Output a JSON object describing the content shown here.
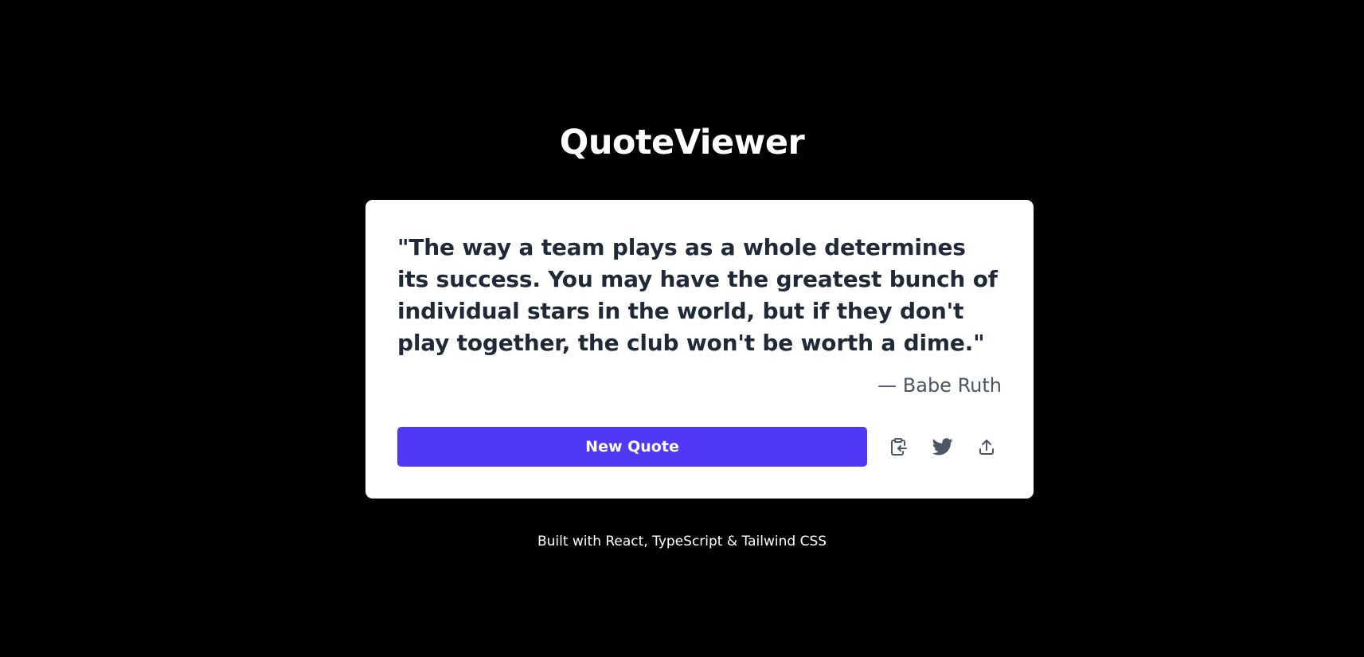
{
  "app": {
    "title": "QuoteViewer"
  },
  "quote": {
    "text": "\"The way a team plays as a whole determines its success. You may have the greatest bunch of individual stars in the world, but if they don't play together, the club won't be worth a dime.\"",
    "author": "— Babe Ruth"
  },
  "actions": {
    "new_quote_label": "New Quote",
    "icons": [
      "clipboard-copy-icon",
      "twitter-icon",
      "share-upload-icon"
    ]
  },
  "footer": {
    "text": "Built with React, TypeScript & Tailwind CSS"
  },
  "colors": {
    "background": "#000000",
    "card": "#ffffff",
    "accent": "#4f39f6",
    "quote_text": "#1f2937",
    "author_text": "#4b5563",
    "icon": "#4b5563"
  }
}
